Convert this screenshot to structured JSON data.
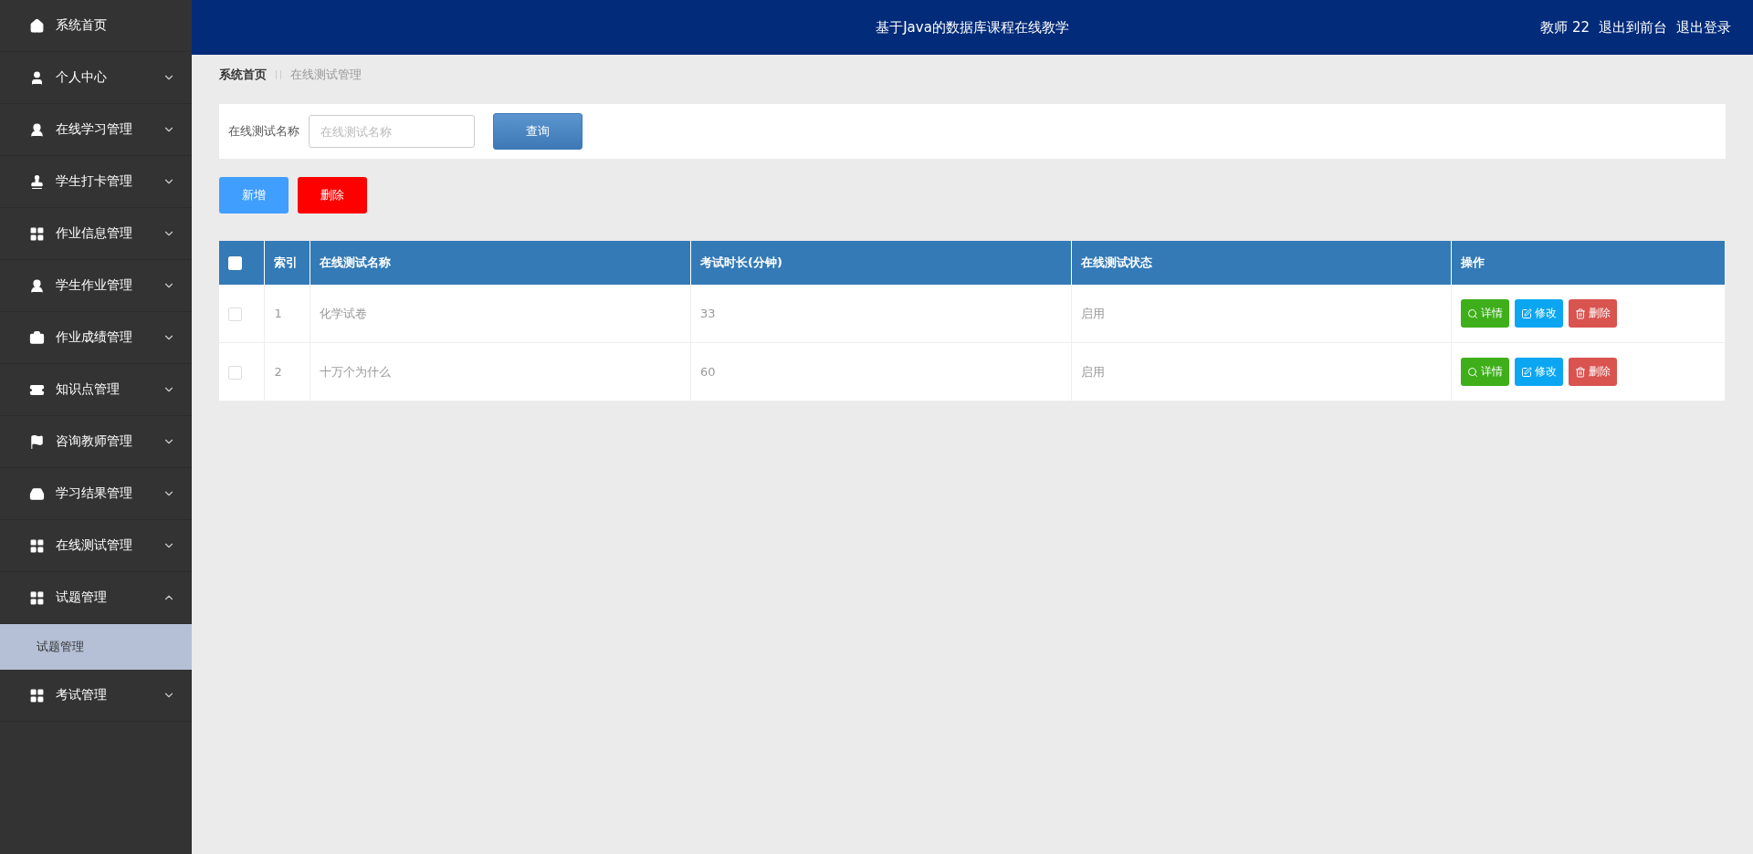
{
  "sidebar": {
    "items": [
      {
        "label": "系统首页"
      },
      {
        "label": "个人中心",
        "expanded": false
      },
      {
        "label": "在线学习管理",
        "expanded": false
      },
      {
        "label": "学生打卡管理",
        "expanded": false
      },
      {
        "label": "作业信息管理",
        "expanded": false
      },
      {
        "label": "学生作业管理",
        "expanded": false
      },
      {
        "label": "作业成绩管理",
        "expanded": false
      },
      {
        "label": "知识点管理",
        "expanded": false
      },
      {
        "label": "咨询教师管理",
        "expanded": false
      },
      {
        "label": "学习结果管理",
        "expanded": false
      },
      {
        "label": "在线测试管理",
        "expanded": false
      },
      {
        "label": "试题管理",
        "expanded": true,
        "children": [
          {
            "label": "试题管理",
            "selected": true
          }
        ]
      },
      {
        "label": "考试管理",
        "expanded": false
      }
    ]
  },
  "header": {
    "title": "基于Java的数据库课程在线教学",
    "user": "教师 22",
    "links": [
      "退出到前台",
      "退出登录"
    ]
  },
  "breadcrumb": [
    "系统首页",
    "在线测试管理"
  ],
  "search": {
    "label": "在线测试名称",
    "placeholder": "在线测试名称",
    "button": "查询"
  },
  "actions": [
    {
      "kind": "add",
      "label": "新增"
    },
    {
      "kind": "delete",
      "label": "删除"
    }
  ],
  "table": {
    "select_all": {
      "checked": false
    },
    "columns": [
      "索引",
      "在线测试名称",
      "考试时长(分钟)",
      "在线测试状态",
      "操作"
    ],
    "rows": [
      {
        "checked": false,
        "cells": [
          "1",
          "化学试卷",
          "33",
          "启用"
        ],
        "buttons": [
          {
            "kind": "detail",
            "label": "详情"
          },
          {
            "kind": "edit",
            "label": "修改"
          },
          {
            "kind": "delete",
            "label": "删除"
          }
        ]
      },
      {
        "checked": false,
        "cells": [
          "2",
          "十万个为什么",
          "60",
          "启用"
        ],
        "buttons": [
          {
            "kind": "detail",
            "label": "详情"
          },
          {
            "kind": "edit",
            "label": "修改"
          },
          {
            "kind": "delete",
            "label": "删除"
          }
        ]
      }
    ]
  }
}
